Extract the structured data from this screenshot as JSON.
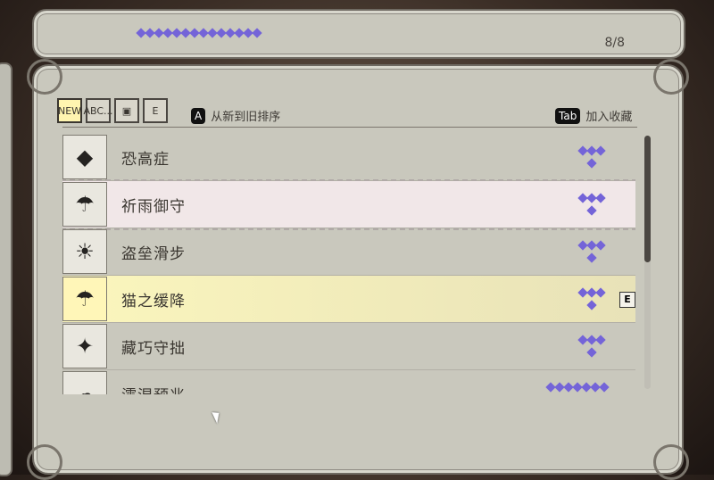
{
  "header": {
    "page_indicator": "8/8",
    "ornament_icon": "purple-diamond-crest-icon"
  },
  "filters": {
    "tabs": [
      {
        "label": "NEW",
        "icon": "new-sparkle-icon",
        "active": true
      },
      {
        "label": "ABC...",
        "icon": "abc-sort-icon",
        "active": false
      },
      {
        "label": "",
        "icon": "box-category-icon",
        "active": false
      },
      {
        "label": "E",
        "icon": "equipped-filter-icon",
        "active": false
      }
    ],
    "sort": {
      "key": "A",
      "label": "从新到旧排序"
    },
    "favorite": {
      "key": "Tab",
      "label": "加入收藏"
    }
  },
  "skills": [
    {
      "name": "恐高症",
      "icon": "cat-float-gem-icon",
      "rating": 4,
      "state": "normal"
    },
    {
      "name": "祈雨御守",
      "icon": "cat-rain-charm-icon",
      "rating": 4,
      "state": "selected"
    },
    {
      "name": "盗垒滑步",
      "icon": "cat-sliding-icon",
      "rating": 4,
      "state": "normal"
    },
    {
      "name": "猫之缓降",
      "icon": "cat-umbrella-icon",
      "rating": 4,
      "state": "highlight",
      "equipped_label": "E"
    },
    {
      "name": "藏巧守拙",
      "icon": "cat-dizzy-icon",
      "rating": 4,
      "state": "normal"
    },
    {
      "name": "濡湿预兆",
      "icon": "cat-raindrop-icon",
      "rating": 8,
      "state": "normal"
    }
  ],
  "colors": {
    "accent": "#7464d8",
    "panel": "#c9c8bd",
    "highlight": "#fbf6bd"
  },
  "scroll": {
    "position_fraction": 0.5
  }
}
